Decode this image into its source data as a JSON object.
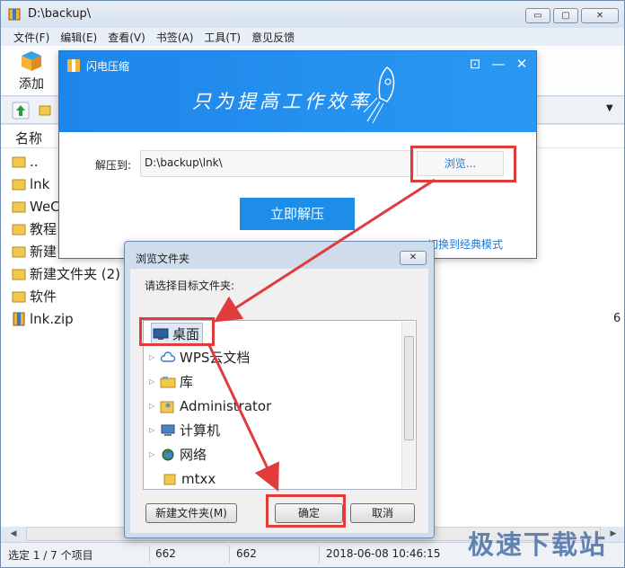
{
  "window": {
    "title": "D:\\backup\\",
    "buttons": {
      "min": "▭",
      "max": "▢",
      "close": "✕"
    }
  },
  "menubar": [
    "文件(F)",
    "编辑(E)",
    "查看(V)",
    "书签(A)",
    "工具(T)",
    "意见反馈"
  ],
  "toolbar": {
    "add_label": "添加"
  },
  "list": {
    "col_name": "名称",
    "rows": [
      "..",
      "lnk",
      "WeC",
      "教程",
      "新建",
      "新建文件夹 (2)",
      "软件",
      "lnk.zip"
    ],
    "right_fragment": "6"
  },
  "status": {
    "selection": "选定 1 / 7 个项目",
    "size1": "662",
    "size2": "662",
    "datetime": "2018-06-08 10:46:15"
  },
  "flash": {
    "title": "闪电压缩",
    "slogan": "只为提高工作效率",
    "extract_label": "解压到:",
    "extract_path": "D:\\backup\\lnk\\",
    "browse_label": "浏览...",
    "extract_now": "立即解压",
    "classic_mode": "切换到经典模式"
  },
  "browse_dialog": {
    "title": "浏览文件夹",
    "prompt": "请选择目标文件夹:",
    "tree": [
      "桌面",
      "WPS云文档",
      "库",
      "Administrator",
      "计算机",
      "网络",
      "mtxx"
    ],
    "new_folder": "新建文件夹(M)",
    "ok": "确定",
    "cancel": "取消"
  },
  "watermark": "极速下载站",
  "colors": {
    "accent": "#1e8de8",
    "highlight": "#e23b3b"
  }
}
